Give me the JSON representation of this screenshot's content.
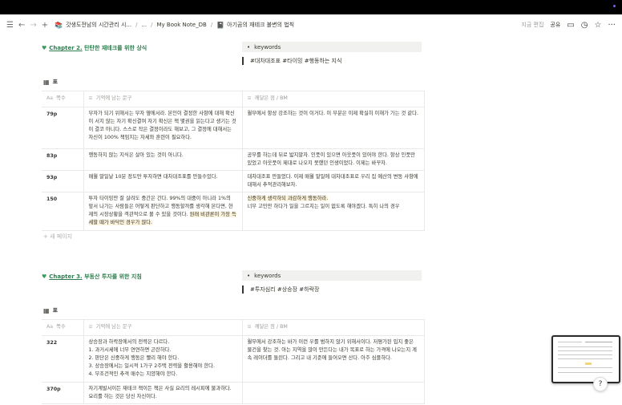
{
  "nav": {
    "breadcrumbs": [
      "갓생도전남의 시간관리 시...",
      "...",
      "My Book Note_DB",
      "아기곰의 재테크 불변의 법칙"
    ],
    "edited": "지금 편집",
    "share": "공유"
  },
  "sections": [
    {
      "chapter_prefix": "Chapter 2.",
      "chapter_rest": " 탄탄한 재테크를 위한 상식",
      "keywords_label": "keywords",
      "keywords": "#대차대조표 #타이밍 #행동하는 지식",
      "table_label": "표",
      "headers": [
        "쪽수",
        "기억에 남는 문구",
        "깨달은 점 / BM"
      ],
      "rows": [
        {
          "page": "79p",
          "quote": "부자가 되기 위해서는 부자 옆에서라. 본인이 결정한 사항에 대해 확신이 서지 않는 자기 확신결여 자기 확신은 책 몇권을 읽는다고 생기는 것이 결코 아니다. 스스로 작은 결정이라도 해보고, 그 결정에 대해서는 자신이 100% 책임지는 자세와 훈련이 필요하다.",
          "note": "월부에서 항상 강조하는 것이 이거다. 이 부분은 이제 확실히 이해가 가는 것 같다."
        },
        {
          "page": "83p",
          "quote": "행동하지 않는 지식은 살아 있는 것이 아니다.",
          "note": "공부를 하는데 뒤로 밟지말자. 인풋이 있으면 아웃풋이 있어야 한다. 항상 인풋만 있었고 아웃풋이 제대로 나오지 못했던 인생이었다. 이제는 바꾸자."
        },
        {
          "page": "93p",
          "quote": "매월 말일날 10분 정도만 투자하면 대차대조표를 만들수있다.",
          "note": "대차대조표 만들었다. 이제 매월 말일에 대차대조표로 우리 집 예산의 변동 사항에 대해서 추적관리해보자."
        },
        {
          "page": "150",
          "quote_a": "투자 타이밍만 잘 살려도 중간은 간다. 99%의 대중이 아니라 1%의 앞서 나가는 사람들은 어떻게 판단하고 행동할까를 생각해 본다면, 현재의 시장상황을 객관적으로 볼 수 있을 것이다. ",
          "quote_hl": "원래 비관론이 가장 득세할 때가 바닥인 경우가 많다.",
          "note_hl": "신중하게 생각하되 과감하게 행동하라.",
          "note_b": "너무 고민만 하다가 일을 그르치는 일이 없도록 해야겠다. 특히 나의 경우"
        }
      ],
      "new_page": "새 페이지"
    },
    {
      "chapter_prefix": "Chapter 3.",
      "chapter_rest": " 부동산 투자를 위한 지침",
      "keywords_label": "keywords",
      "keywords": "#투자심리 #상승장 #하락장",
      "table_label": "표",
      "headers": [
        "쪽수",
        "기억에 남는 문구",
        "깨달은 점 / BM"
      ],
      "rows": [
        {
          "page": "322",
          "quote_lines": [
            "상승장과 하락장에서의 전략은 다르다.",
            "1. 과거시세에 너무 연연하면 곤란하다.",
            "2. 판단은 신중하게 행동은 빨리 해야 한다.",
            "3. 상승장에서는 일시적 1가구 2주택 전략을 활용해야 한다.",
            "4. 무조건적인 추격 매수는 지양해야 한다."
          ],
          "note": "월부에서 강조하는 바가 이런 우를 범하지 않기 위해서이다. 저평가된 입지 좋은 물건을 찾는 것. 아는 지역을 많이 만든다는 내가 목표로 하는 가격에 나오는지 계속 레이더를 돌린다. 그리고 내 기준에 들어오면 산다. 아주 심플하다."
        },
        {
          "page": "370p",
          "quote": "자기계발서이든 재테크 책이든 책은 사실 요리의 레시피에 불과하다. 요리를 하는 것은 당신 자신이다.",
          "note": ""
        }
      ]
    }
  ]
}
